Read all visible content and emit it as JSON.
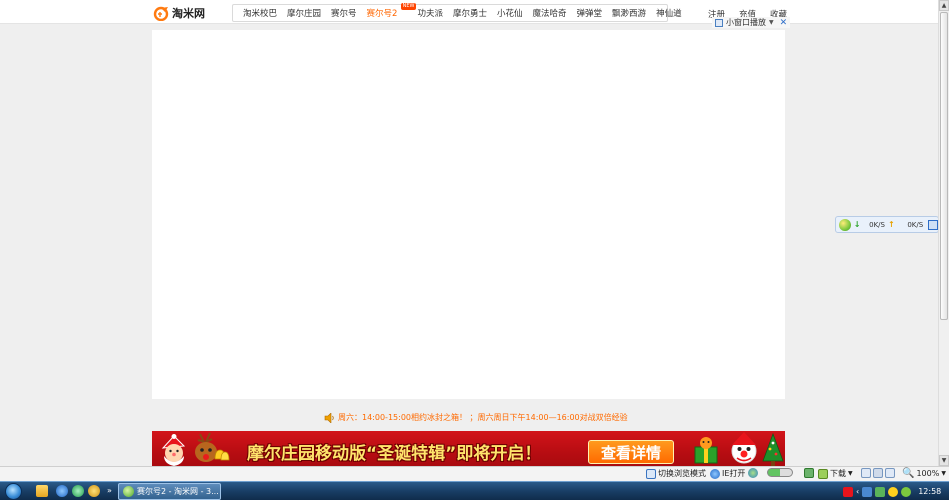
{
  "site": {
    "logo_text": "淘米网"
  },
  "nav": {
    "items": [
      {
        "label": "淘米校巴",
        "active": false
      },
      {
        "label": "摩尔庄园",
        "active": false
      },
      {
        "label": "赛尔号",
        "active": false
      },
      {
        "label": "赛尔号2",
        "active": true,
        "badge": "NEW"
      },
      {
        "label": "功夫派",
        "active": false
      },
      {
        "label": "摩尔勇士",
        "active": false
      },
      {
        "label": "小花仙",
        "active": false
      },
      {
        "label": "魔法哈奇",
        "active": false
      },
      {
        "label": "弹弹堂",
        "active": false
      },
      {
        "label": "飘渺西游",
        "active": false
      },
      {
        "label": "神仙道",
        "active": false
      }
    ],
    "links": [
      "注册",
      "充值",
      "收藏"
    ],
    "small_window_label": "小窗口播放"
  },
  "notice": {
    "text": "周六：14:00-15:00相约冰封之箱！ ；周六周日下午14:00—16:00对战双倍经验"
  },
  "banner": {
    "headline": "摩尔庄园移动版“圣诞特辑”即将开启！",
    "cta_label": "查看详情"
  },
  "speed_widget": {
    "download_speed": "0K/S",
    "upload_speed": "0K/S"
  },
  "statusbar": {
    "switch_mode_label": "切换浏览模式",
    "ie_open_label": "IE打开",
    "download_label": "下载",
    "zoom_label": "100%"
  },
  "taskbar": {
    "task_label": "赛尔号2 - 淘米网 - 3...",
    "clock": "12:58"
  },
  "colors": {
    "accent_orange": "#ff6600",
    "banner_red": "#c8101a",
    "cta_orange": "#ff7a10",
    "taskbar_blue": "#1c4670"
  }
}
